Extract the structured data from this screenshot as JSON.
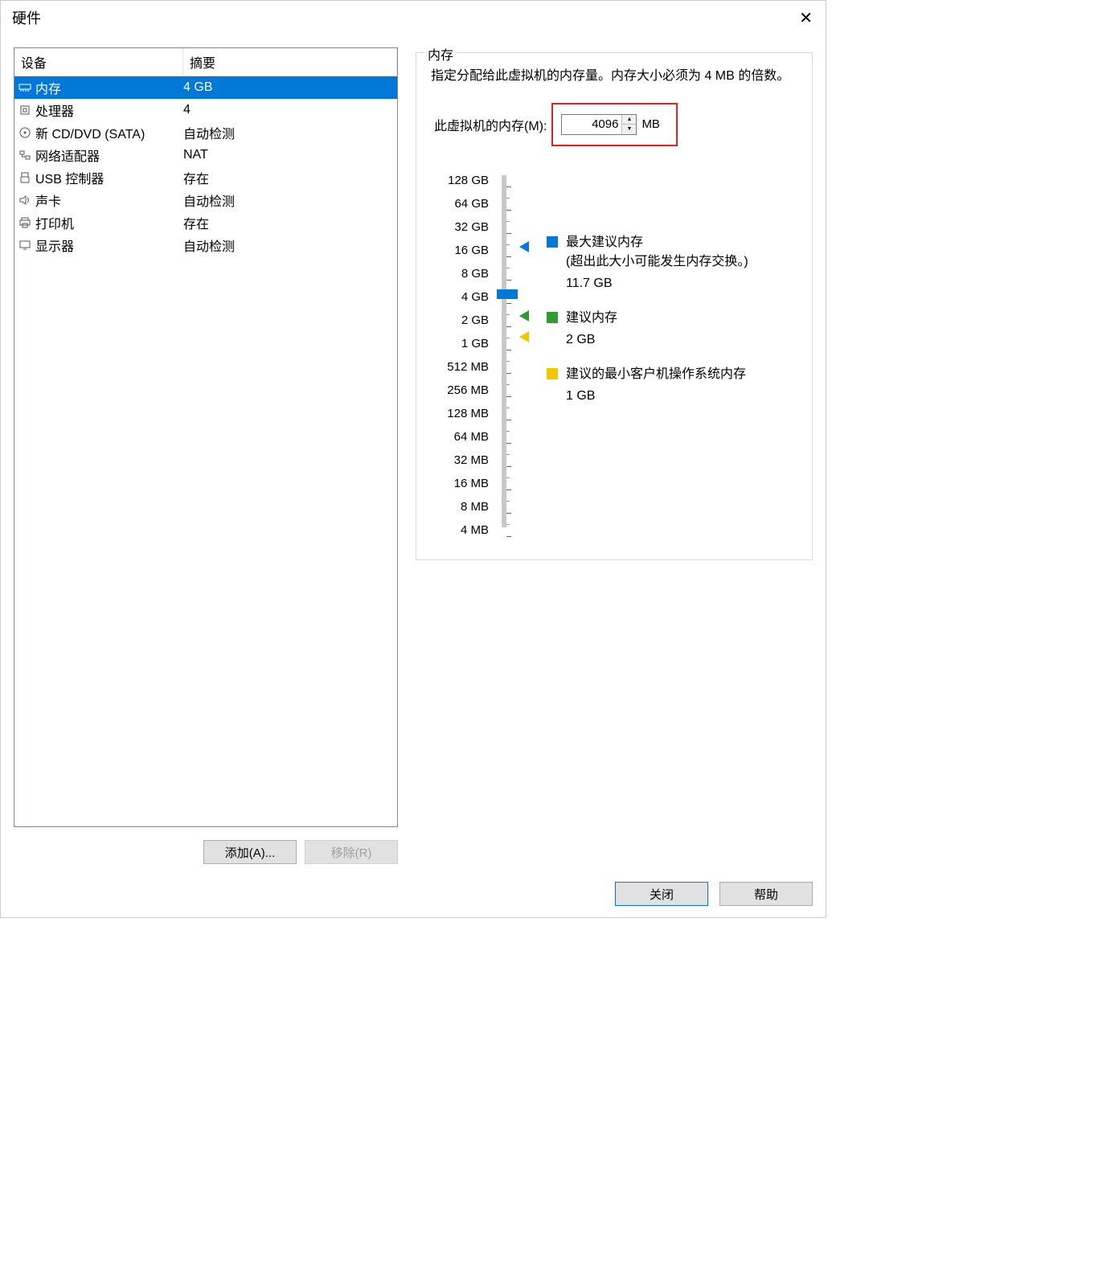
{
  "window": {
    "title": "硬件"
  },
  "table": {
    "headers": {
      "device": "设备",
      "summary": "摘要"
    },
    "rows": [
      {
        "icon": "memory",
        "device": "内存",
        "summary": "4 GB",
        "selected": true
      },
      {
        "icon": "cpu",
        "device": "处理器",
        "summary": "4"
      },
      {
        "icon": "disc",
        "device": "新 CD/DVD (SATA)",
        "summary": "自动检测"
      },
      {
        "icon": "network",
        "device": "网络适配器",
        "summary": "NAT"
      },
      {
        "icon": "usb",
        "device": "USB 控制器",
        "summary": "存在"
      },
      {
        "icon": "sound",
        "device": "声卡",
        "summary": "自动检测"
      },
      {
        "icon": "printer",
        "device": "打印机",
        "summary": "存在"
      },
      {
        "icon": "display",
        "device": "显示器",
        "summary": "自动检测"
      }
    ]
  },
  "left_buttons": {
    "add": "添加(A)...",
    "remove": "移除(R)"
  },
  "memory_panel": {
    "legend": "内存",
    "description": "指定分配给此虚拟机的内存量。内存大小必须为 4 MB 的倍数。",
    "input_label": "此虚拟机的内存(M):",
    "input_value": "4096",
    "unit": "MB",
    "ticks": [
      "128 GB",
      "64 GB",
      "32 GB",
      "16 GB",
      "8 GB",
      "4 GB",
      "2 GB",
      "1 GB",
      "512 MB",
      "256 MB",
      "128 MB",
      "64 MB",
      "32 MB",
      "16 MB",
      "8 MB",
      "4 MB"
    ],
    "markers": {
      "max": {
        "color": "#0078d7",
        "label": "最大建议内存",
        "sub": "(超出此大小可能发生内存交换。)",
        "value": "11.7 GB"
      },
      "rec": {
        "color": "#2e9c2e",
        "label": "建议内存",
        "value": "2 GB"
      },
      "min": {
        "color": "#f0c800",
        "label": "建议的最小客户机操作系统内存",
        "value": "1 GB"
      }
    }
  },
  "bottom": {
    "close": "关闭",
    "help": "帮助"
  }
}
